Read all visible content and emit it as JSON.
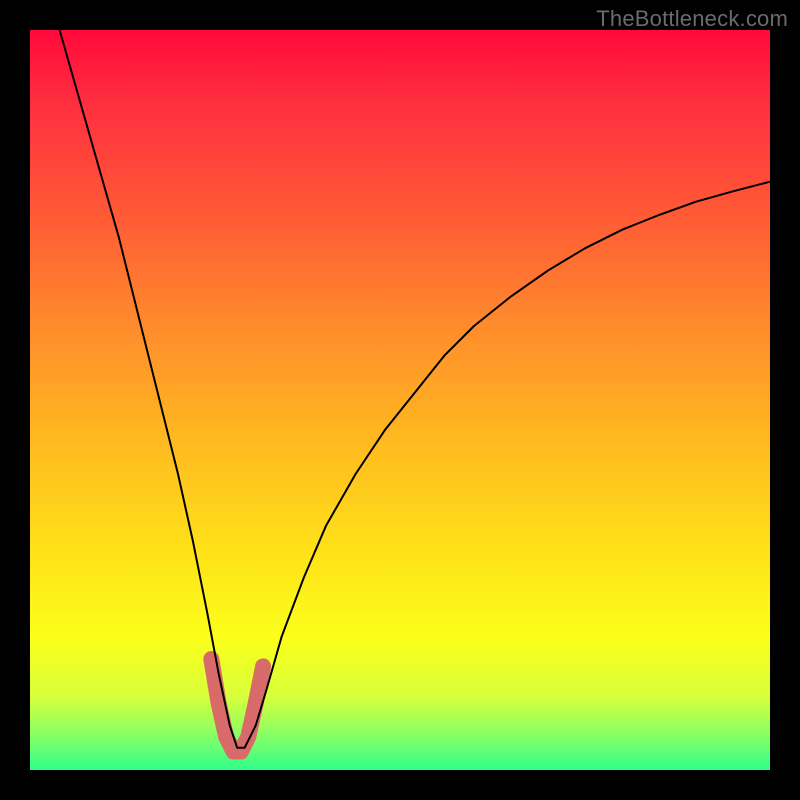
{
  "watermark": "TheBottleneck.com",
  "chart_data": {
    "type": "line",
    "title": "",
    "xlabel": "",
    "ylabel": "",
    "xlim": [
      0,
      100
    ],
    "ylim": [
      0,
      100
    ],
    "grid": false,
    "legend": false,
    "series": [
      {
        "name": "bottleneck-curve",
        "color": "#000000",
        "stroke_width": 2,
        "x": [
          4,
          6,
          8,
          10,
          12,
          14,
          16,
          18,
          20,
          22,
          24,
          25.5,
          27,
          28,
          29,
          30.5,
          32,
          34,
          37,
          40,
          44,
          48,
          52,
          56,
          60,
          65,
          70,
          75,
          80,
          85,
          90,
          95,
          100
        ],
        "y": [
          100,
          93,
          86,
          79,
          72,
          64,
          56,
          48,
          40,
          31,
          21,
          13,
          6,
          3,
          3,
          6,
          11,
          18,
          26,
          33,
          40,
          46,
          51,
          56,
          60,
          64,
          67.5,
          70.5,
          73,
          75,
          76.8,
          78.2,
          79.5
        ]
      },
      {
        "name": "bottleneck-valley-highlight",
        "color": "#d86a6a",
        "stroke_width": 16,
        "x": [
          24.5,
          25.5,
          26.5,
          27.5,
          28.5,
          29.5,
          30.5,
          31.5
        ],
        "y": [
          15,
          9,
          4.5,
          2.5,
          2.5,
          4.5,
          9,
          14
        ]
      }
    ],
    "background_gradient": {
      "direction": "top-to-bottom",
      "stops": [
        {
          "pos": 0,
          "color": "#ff0a3a"
        },
        {
          "pos": 25,
          "color": "#ff5a35"
        },
        {
          "pos": 55,
          "color": "#ffb820"
        },
        {
          "pos": 82,
          "color": "#fcff1a"
        },
        {
          "pos": 100,
          "color": "#2fff8a"
        }
      ]
    }
  }
}
